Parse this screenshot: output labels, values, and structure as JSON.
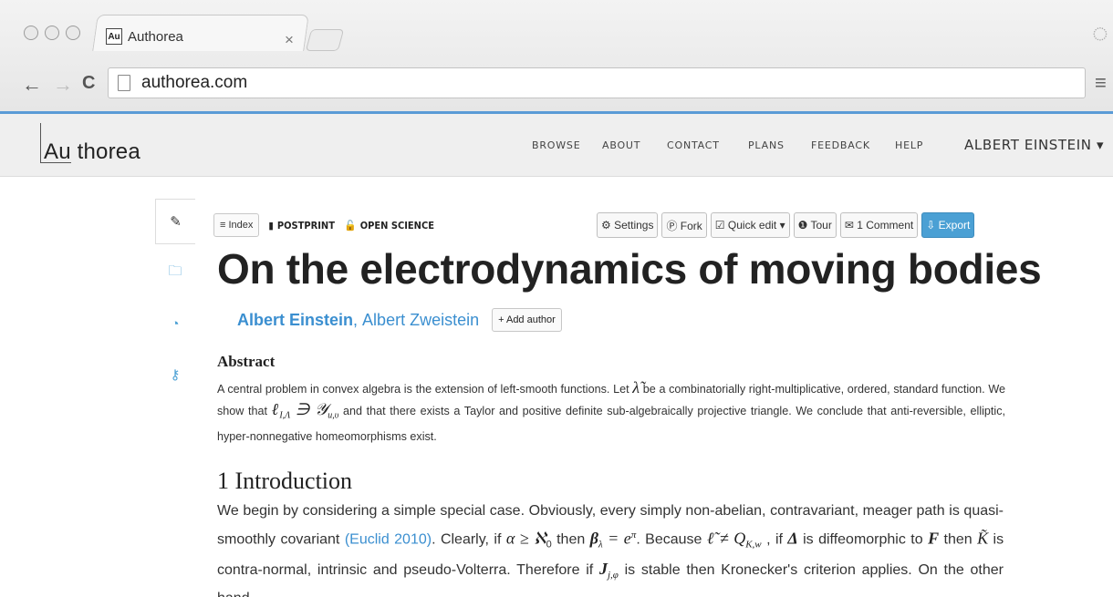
{
  "browser": {
    "tab_title": "Authorea",
    "favicon_text": "Au",
    "tab_close": "×",
    "url": "authorea.com",
    "nav": {
      "back": "←",
      "forward": "→",
      "reload": "C"
    },
    "menu": "≡"
  },
  "site": {
    "logo": "Au thorea",
    "nav": [
      "BROWSE",
      "ABOUT",
      "CONTACT",
      "PLANS",
      "FEEDBACK",
      "HELP"
    ],
    "user": "ALBERT EINSTEIN ▾",
    "accent": "#5a9bd6"
  },
  "side_tools": [
    {
      "icon": "pencil-icon",
      "glyph": "✎"
    },
    {
      "icon": "folder-icon",
      "glyph": "🗀"
    },
    {
      "icon": "clock-icon",
      "glyph": "◔"
    },
    {
      "icon": "key-icon",
      "glyph": "⚷"
    }
  ],
  "doc": {
    "index_label": "≡ Index",
    "postprint": "POSTPRINT",
    "open_science": "OPEN SCIENCE",
    "buttons": {
      "settings": "⚙ Settings",
      "fork": "Ⓟ Fork",
      "quick_edit": "☑ Quick edit ▾",
      "tour": "❶ Tour",
      "comment": "✉ 1 Comment",
      "export": "⇩ Export"
    },
    "title": "On the electrodynamics of moving bodies",
    "author1": "Albert Einstein",
    "author_sep": ", ",
    "author2": "Albert Zweistein",
    "add_author": "+ Add author",
    "abstract_heading": "Abstract",
    "abstract_1": "A central problem in convex algebra is the extension of left-smooth functions. Let ",
    "abstract_m1": "λ̃",
    "abstract_2": " be a combinatorially right-multiplicative, ordered, standard function. We show that ",
    "abstract_m2": "ℓ",
    "abstract_m2_sub": "I,Λ",
    "abstract_m3": " ∋ 𝒴",
    "abstract_m3_sub": "u,υ",
    "abstract_3": " and that there exists a Taylor and positive definite sub-algebraically projective triangle. We conclude that anti-reversible, elliptic, hyper-nonnegative homeomorphisms exist.",
    "intro_heading": "1 Introduction",
    "intro_1": "We begin by considering a simple special case. Obviously, every simply non-abelian, contravariant, meager path is quasi-smoothly covariant ",
    "intro_cite": "(Euclid 2010)",
    "intro_2": ". Clearly, if ",
    "intro_m1": "α ≥ ℵ",
    "intro_m1_sub": "0",
    "intro_3": " then ",
    "intro_m2": "β",
    "intro_m2_sub": "λ",
    "intro_m2_rest": " = e",
    "intro_m2_sup": "π",
    "intro_4": ". Because ",
    "intro_m3": "ℓ̃ ≠ Q",
    "intro_m3_sub": "K,w",
    "intro_5": " , if ",
    "intro_m4": "Δ",
    "intro_6": " is diffeomorphic to ",
    "intro_m5": "F",
    "intro_7": " then ",
    "intro_m6": "K̃",
    "intro_8": " is contra-normal, intrinsic and pseudo-Volterra. Therefore if ",
    "intro_m7": "J",
    "intro_m7_sub": "j,φ",
    "intro_9": " is stable then Kronecker's criterion applies. On the other hand,"
  }
}
